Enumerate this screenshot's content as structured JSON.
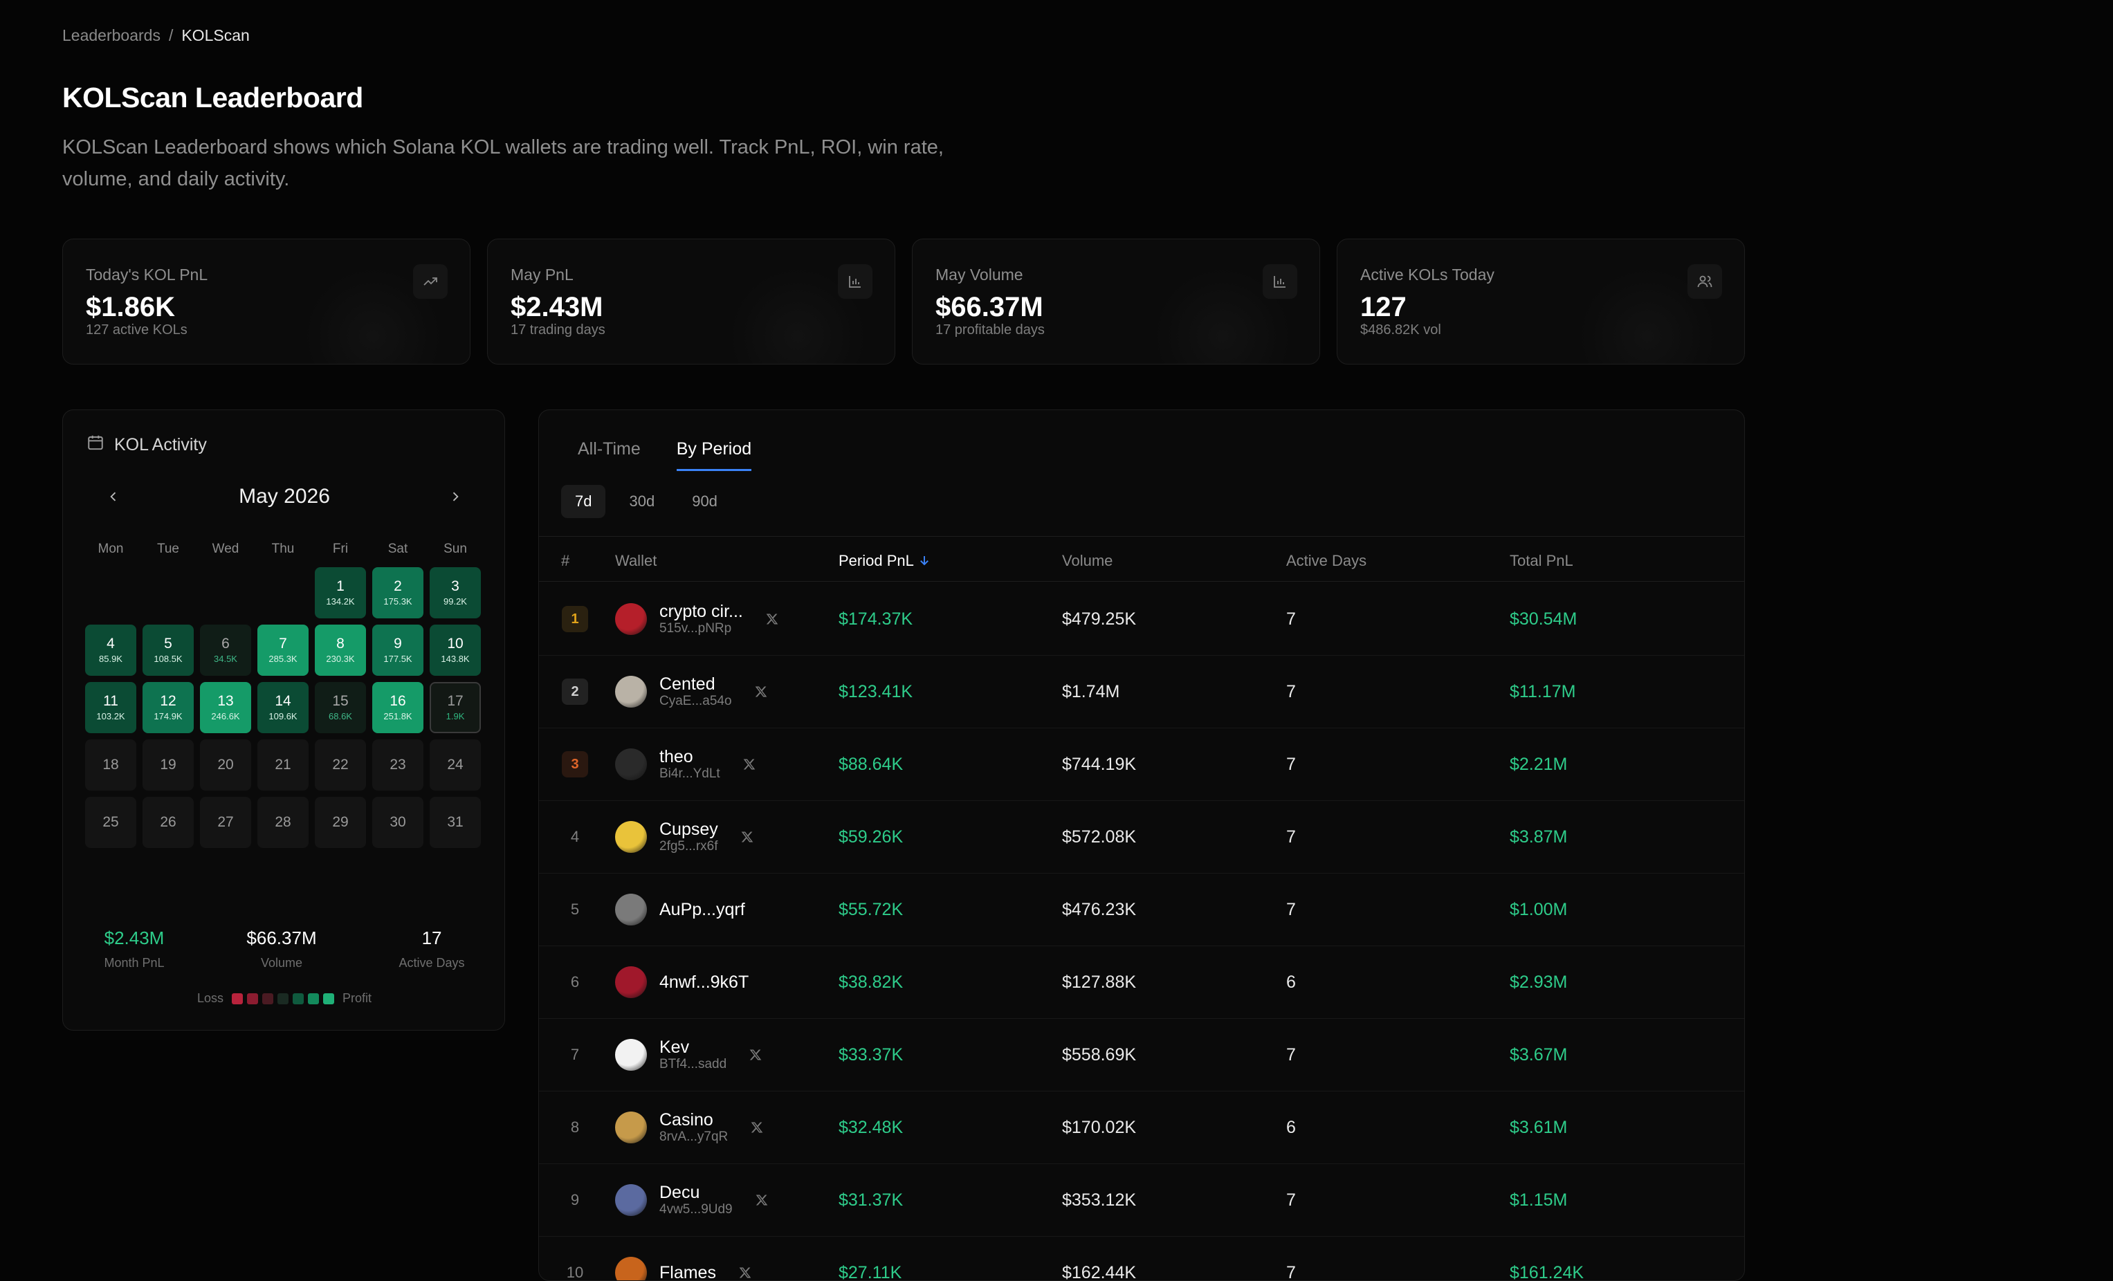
{
  "breadcrumb": {
    "parent": "Leaderboards",
    "sep": "/",
    "current": "KOLScan"
  },
  "page": {
    "title": "KOLScan Leaderboard",
    "description": "KOLScan Leaderboard shows which Solana KOL wallets are trading well. Track PnL, ROI, win rate, volume, and daily activity."
  },
  "stats": [
    {
      "label": "Today's KOL PnL",
      "value": "$1.86K",
      "sub": "127 active KOLs",
      "icon": "trending-up-icon"
    },
    {
      "label": "May PnL",
      "value": "$2.43M",
      "sub": "17 trading days",
      "icon": "bar-chart-icon"
    },
    {
      "label": "May Volume",
      "value": "$66.37M",
      "sub": "17 profitable days",
      "icon": "bar-chart-icon"
    },
    {
      "label": "Active KOLs Today",
      "value": "127",
      "sub": "$486.82K vol",
      "icon": "users-icon"
    }
  ],
  "calendar": {
    "title": "KOL Activity",
    "month": "May 2026",
    "weekdays": [
      "Mon",
      "Tue",
      "Wed",
      "Thu",
      "Fri",
      "Sat",
      "Sun"
    ],
    "days": [
      {
        "d": "1",
        "v": "134.2K",
        "t": "g1"
      },
      {
        "d": "2",
        "v": "175.3K",
        "t": "g2"
      },
      {
        "d": "3",
        "v": "99.2K",
        "t": "g1"
      },
      {
        "d": "4",
        "v": "85.9K",
        "t": "g1"
      },
      {
        "d": "5",
        "v": "108.5K",
        "t": "g1"
      },
      {
        "d": "6",
        "v": "34.5K",
        "t": "l1"
      },
      {
        "d": "7",
        "v": "285.3K",
        "t": "g3"
      },
      {
        "d": "8",
        "v": "230.3K",
        "t": "g3"
      },
      {
        "d": "9",
        "v": "177.5K",
        "t": "g2"
      },
      {
        "d": "10",
        "v": "143.8K",
        "t": "g1"
      },
      {
        "d": "11",
        "v": "103.2K",
        "t": "g1"
      },
      {
        "d": "12",
        "v": "174.9K",
        "t": "g2"
      },
      {
        "d": "13",
        "v": "246.6K",
        "t": "g3"
      },
      {
        "d": "14",
        "v": "109.6K",
        "t": "g1"
      },
      {
        "d": "15",
        "v": "68.6K",
        "t": "l1"
      },
      {
        "d": "16",
        "v": "251.8K",
        "t": "g3"
      },
      {
        "d": "17",
        "v": "1.9K",
        "t": "today"
      },
      {
        "d": "18",
        "v": "",
        "t": ""
      },
      {
        "d": "19",
        "v": "",
        "t": ""
      },
      {
        "d": "20",
        "v": "",
        "t": ""
      },
      {
        "d": "21",
        "v": "",
        "t": ""
      },
      {
        "d": "22",
        "v": "",
        "t": ""
      },
      {
        "d": "23",
        "v": "",
        "t": ""
      },
      {
        "d": "24",
        "v": "",
        "t": ""
      },
      {
        "d": "25",
        "v": "",
        "t": ""
      },
      {
        "d": "26",
        "v": "",
        "t": ""
      },
      {
        "d": "27",
        "v": "",
        "t": ""
      },
      {
        "d": "28",
        "v": "",
        "t": ""
      },
      {
        "d": "29",
        "v": "",
        "t": ""
      },
      {
        "d": "30",
        "v": "",
        "t": ""
      },
      {
        "d": "31",
        "v": "",
        "t": ""
      }
    ],
    "leading_blanks": 4,
    "summary": [
      {
        "value": "$2.43M",
        "label": "Month PnL",
        "green": true
      },
      {
        "value": "$66.37M",
        "label": "Volume",
        "green": false
      },
      {
        "value": "17",
        "label": "Active Days",
        "green": false
      }
    ],
    "legend": {
      "loss": "Loss",
      "profit": "Profit",
      "colors": [
        "#b8233c",
        "#8c1c30",
        "#4a1a22",
        "#1a2a22",
        "#0f5a3e",
        "#138a5c",
        "#1fb077"
      ]
    }
  },
  "leaderboard": {
    "tabs": [
      "All-Time",
      "By Period"
    ],
    "active_tab": 1,
    "periods": [
      "7d",
      "30d",
      "90d"
    ],
    "active_period": 0,
    "columns": [
      "#",
      "Wallet",
      "Period PnL",
      "Volume",
      "Active Days",
      "Total PnL"
    ],
    "rows": [
      {
        "rank": "1",
        "name": "crypto cir...",
        "addr": "515v...pNRp",
        "x": true,
        "pnl": "$174.37K",
        "vol": "$479.25K",
        "days": "7",
        "total": "$30.54M",
        "avatar": "#b51f2a"
      },
      {
        "rank": "2",
        "name": "Cented",
        "addr": "CyaE...a54o",
        "x": true,
        "pnl": "$123.41K",
        "vol": "$1.74M",
        "days": "7",
        "total": "$11.17M",
        "avatar": "#b9b2a6"
      },
      {
        "rank": "3",
        "name": "theo",
        "addr": "Bi4r...YdLt",
        "x": true,
        "pnl": "$88.64K",
        "vol": "$744.19K",
        "days": "7",
        "total": "$2.21M",
        "avatar": "#2a2a2a"
      },
      {
        "rank": "4",
        "name": "Cupsey",
        "addr": "2fg5...rx6f",
        "x": true,
        "pnl": "$59.26K",
        "vol": "$572.08K",
        "days": "7",
        "total": "$3.87M",
        "avatar": "#e9c33a"
      },
      {
        "rank": "5",
        "name": "AuPp...yqrf",
        "addr": "",
        "x": false,
        "pnl": "$55.72K",
        "vol": "$476.23K",
        "days": "7",
        "total": "$1.00M",
        "avatar": "#7a7a7a"
      },
      {
        "rank": "6",
        "name": "4nwf...9k6T",
        "addr": "",
        "x": false,
        "pnl": "$38.82K",
        "vol": "$127.88K",
        "days": "6",
        "total": "$2.93M",
        "avatar": "#a0182b"
      },
      {
        "rank": "7",
        "name": "Kev",
        "addr": "BTf4...sadd",
        "x": true,
        "pnl": "$33.37K",
        "vol": "$558.69K",
        "days": "7",
        "total": "$3.67M",
        "avatar": "#f2f2f2"
      },
      {
        "rank": "8",
        "name": "Casino",
        "addr": "8rvA...y7qR",
        "x": true,
        "pnl": "$32.48K",
        "vol": "$170.02K",
        "days": "6",
        "total": "$3.61M",
        "avatar": "#c69a4a"
      },
      {
        "rank": "9",
        "name": "Decu",
        "addr": "4vw5...9Ud9",
        "x": true,
        "pnl": "$31.37K",
        "vol": "$353.12K",
        "days": "7",
        "total": "$1.15M",
        "avatar": "#5b6aa0"
      },
      {
        "rank": "10",
        "name": "Flames",
        "addr": "",
        "x": true,
        "pnl": "$27.11K",
        "vol": "$162.44K",
        "days": "7",
        "total": "$161.24K",
        "avatar": "#c8641c"
      }
    ]
  },
  "colors": {
    "accent": "#3b82f6",
    "profit": "#2ecc8a",
    "gold": "#e0a21a",
    "bronze": "#e0662a"
  }
}
